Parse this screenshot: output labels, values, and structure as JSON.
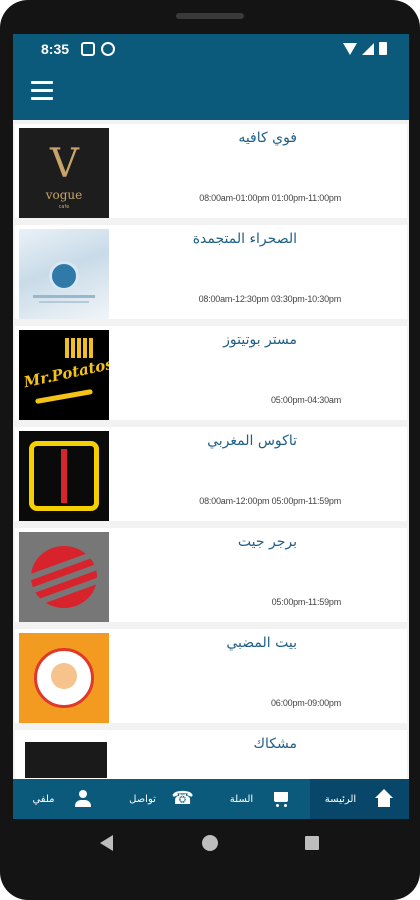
{
  "status_bar": {
    "time": "8:35",
    "icons": [
      "image-icon",
      "sync-icon",
      "wifi-icon",
      "signal-icon",
      "battery-icon"
    ]
  },
  "app_bar": {
    "menu_icon": "hamburger-menu-icon",
    "color": "#0b5a7c"
  },
  "restaurants": [
    {
      "name": "فوي كافيه",
      "hours": "08:00am-01:00pm 01:00pm-11:00pm",
      "logo": "vogue-logo",
      "logo_text": "vogue",
      "logo_subtext": "cafe"
    },
    {
      "name": "الصحراء المتجمدة",
      "hours": "08:00am-12:30pm 03:30pm-10:30pm",
      "logo": "frozen-desert-logo"
    },
    {
      "name": "مستر بوتيتوز",
      "hours": "05:00pm-04:30am",
      "logo": "mr-potatos-logo",
      "logo_text": "Mr.Potatos"
    },
    {
      "name": "تاكوس المغربي",
      "hours": "08:00am-12:00pm 05:00pm-11:59pm",
      "logo": "tacos-maghribi-logo"
    },
    {
      "name": "برجر جيت",
      "hours": "05:00pm-11:59pm",
      "logo": "burger-jet-logo"
    },
    {
      "name": "بيت المضبي",
      "hours": "06:00pm-09:00pm",
      "logo": "bayt-almadbi-logo"
    },
    {
      "name": "مشكاك",
      "hours": "",
      "logo": "mshakak-logo"
    }
  ],
  "bottom_nav": {
    "items": [
      {
        "label": "الرئيسة",
        "icon": "home-icon",
        "active": true
      },
      {
        "label": "السلة",
        "icon": "cart-icon",
        "active": false
      },
      {
        "label": "تواصل",
        "icon": "phone-icon",
        "active": false
      },
      {
        "label": "ملفي",
        "icon": "user-icon",
        "active": false
      }
    ],
    "color": "#0b5a7c",
    "active_color": "#08476a"
  },
  "colors": {
    "primary": "#0b5a7c",
    "title_text": "#1f5f86",
    "list_background": "#f2f2f2"
  }
}
